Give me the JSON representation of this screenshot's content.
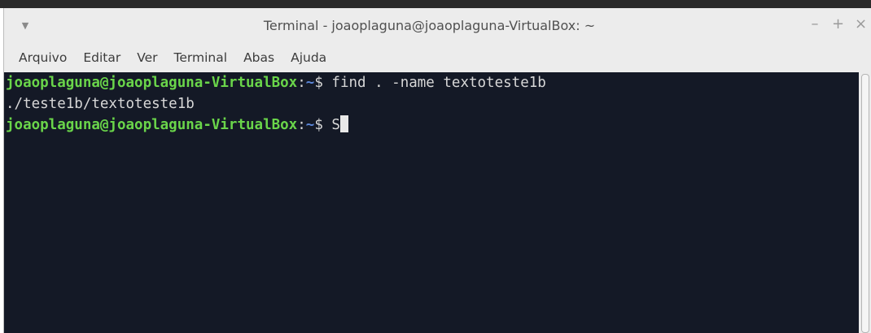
{
  "window": {
    "title": "Terminal - joaoplaguna@joaoplaguna-VirtualBox: ~",
    "menu_arrow": "▼",
    "buttons": {
      "minimize": "–",
      "maximize": "+",
      "close": "×"
    }
  },
  "menubar": {
    "items": [
      {
        "label": "Arquivo"
      },
      {
        "label": "Editar"
      },
      {
        "label": "Ver"
      },
      {
        "label": "Terminal"
      },
      {
        "label": "Abas"
      },
      {
        "label": "Ajuda"
      }
    ]
  },
  "terminal": {
    "lines": [
      {
        "user": "joaoplaguna@joaoplaguna-VirtualBox",
        "sep": ":",
        "path": "~",
        "prompt": "$ ",
        "command": "find . -name textoteste1b"
      },
      {
        "output": "./teste1b/textoteste1b"
      },
      {
        "user": "joaoplaguna@joaoplaguna-VirtualBox",
        "sep": ":",
        "path": "~",
        "prompt": "$ ",
        "command": "S"
      }
    ]
  },
  "colors": {
    "terminal_bg": "#141926",
    "user": "#6ad54a",
    "path": "#5b86d8",
    "text": "#d7d7d7"
  }
}
